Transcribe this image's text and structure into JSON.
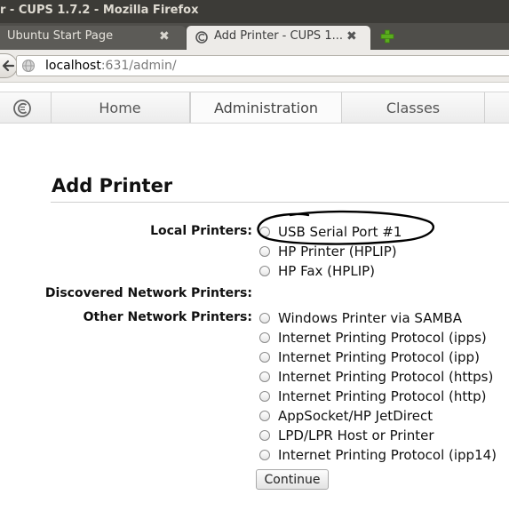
{
  "window": {
    "title": "r - CUPS 1.7.2 - Mozilla Firefox"
  },
  "tabs": [
    {
      "label": "Ubuntu Start Page",
      "close": "✖",
      "active": false
    },
    {
      "label": "Add Printer - CUPS 1...",
      "close": "✖",
      "active": true
    }
  ],
  "icons": {
    "new_tab": "plus-icon",
    "back": "back-arrow-icon",
    "site": "globe-icon",
    "favicon": "cups-favicon-icon",
    "logo": "cups-logo-icon"
  },
  "url": {
    "host": "localhost",
    "rest": ":631/admin/"
  },
  "nav": {
    "home": "Home",
    "administration": "Administration",
    "classes": "Classes"
  },
  "page": {
    "title": "Add Printer",
    "local_label": "Local Printers:",
    "local_options": [
      "USB Serial Port #1",
      "HP Printer (HPLIP)",
      "HP Fax (HPLIP)"
    ],
    "discovered_label": "Discovered Network Printers:",
    "other_label": "Other Network Printers:",
    "other_options": [
      "Windows Printer via SAMBA",
      "Internet Printing Protocol (ipps)",
      "Internet Printing Protocol (ipp)",
      "Internet Printing Protocol (https)",
      "Internet Printing Protocol (http)",
      "AppSocket/HP JetDirect",
      "LPD/LPR Host or Printer",
      "Internet Printing Protocol (ipp14)"
    ],
    "continue": "Continue"
  },
  "colors": {
    "titlebar": "#3c3b37",
    "tabstrip": "#4f4e4a",
    "active_tab": "#edebe8",
    "new_tab_green": "#5aac1e"
  }
}
